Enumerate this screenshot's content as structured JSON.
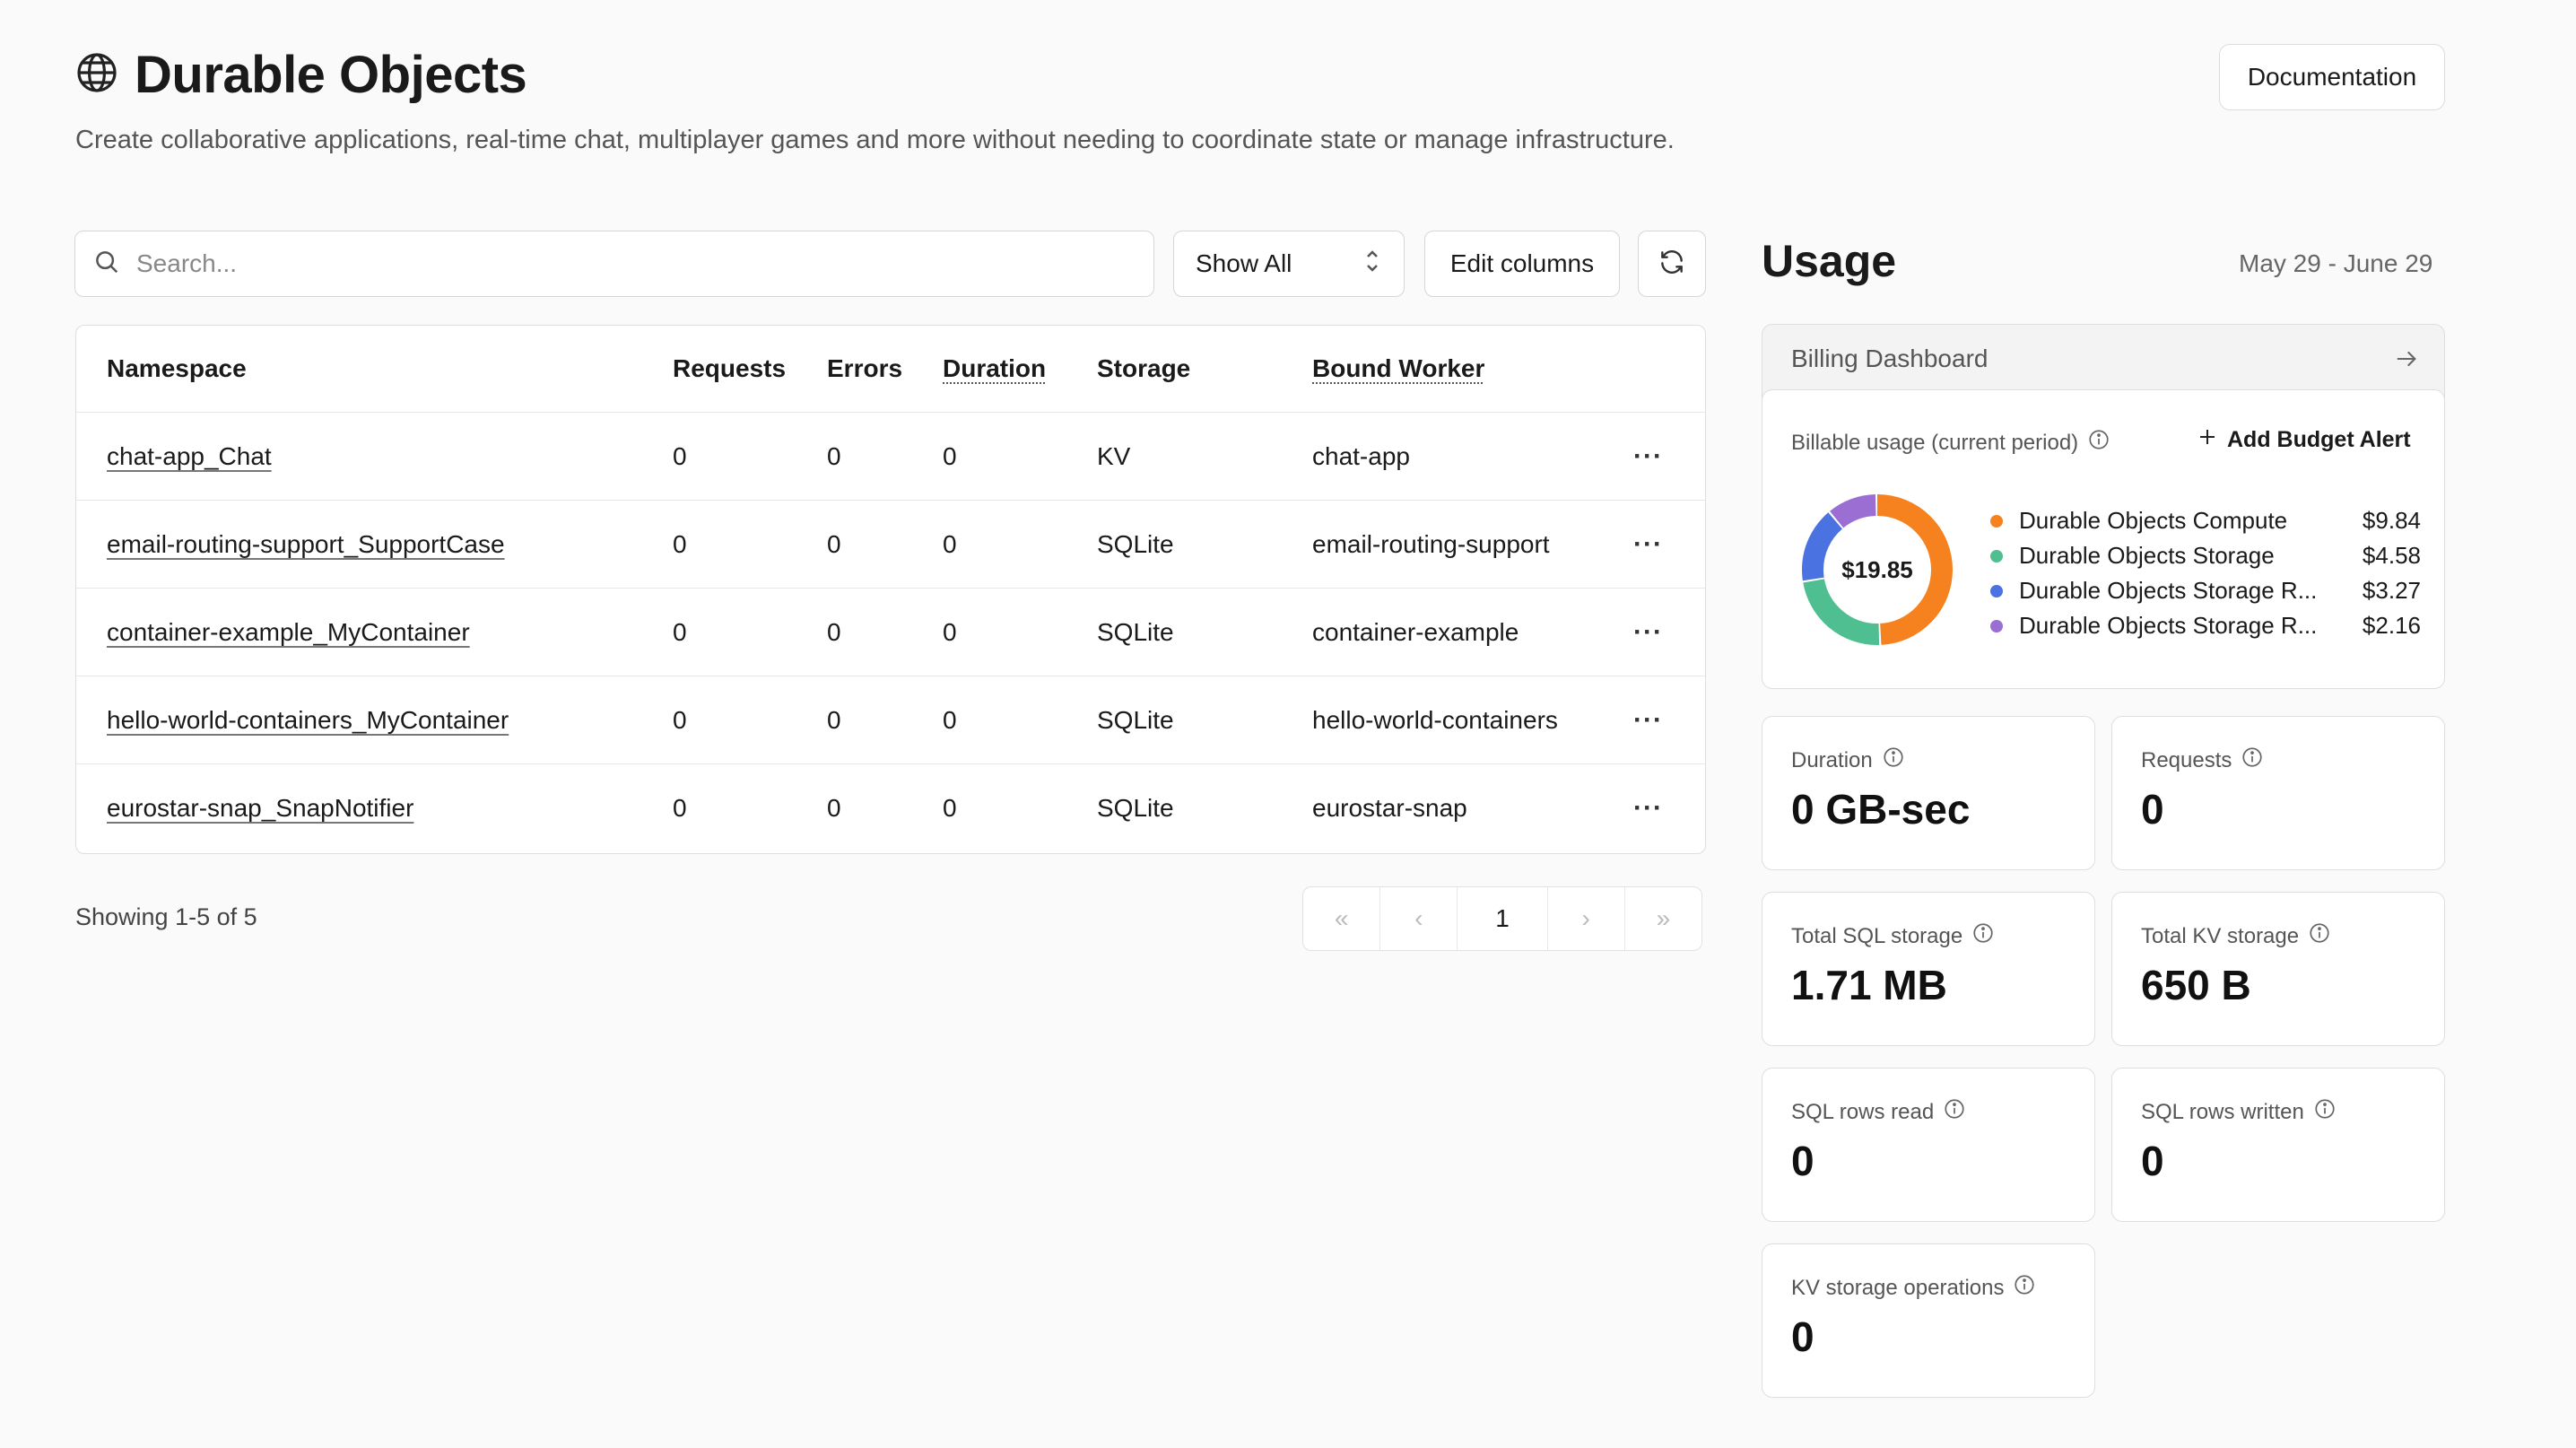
{
  "page": {
    "title": "Durable Objects",
    "subtitle": "Create collaborative applications, real-time chat, multiplayer games and more without needing to coordinate state or manage infrastructure.",
    "documentation_label": "Documentation",
    "icon": "globe-icon"
  },
  "toolbar": {
    "search_placeholder": "Search...",
    "filter_label": "Show All",
    "edit_columns_label": "Edit columns",
    "refresh_icon": "refresh-icon"
  },
  "table": {
    "columns": {
      "namespace": "Namespace",
      "requests": "Requests",
      "errors": "Errors",
      "duration": "Duration",
      "storage": "Storage",
      "bound_worker": "Bound Worker"
    },
    "rows": [
      {
        "namespace": "chat-app_Chat",
        "requests": "0",
        "errors": "0",
        "duration": "0",
        "storage": "KV",
        "bound_worker": "chat-app"
      },
      {
        "namespace": "email-routing-support_SupportCase",
        "requests": "0",
        "errors": "0",
        "duration": "0",
        "storage": "SQLite",
        "bound_worker": "email-routing-support"
      },
      {
        "namespace": "container-example_MyContainer",
        "requests": "0",
        "errors": "0",
        "duration": "0",
        "storage": "SQLite",
        "bound_worker": "container-example"
      },
      {
        "namespace": "hello-world-containers_MyContainer",
        "requests": "0",
        "errors": "0",
        "duration": "0",
        "storage": "SQLite",
        "bound_worker": "hello-world-containers"
      },
      {
        "namespace": "eurostar-snap_SnapNotifier",
        "requests": "0",
        "errors": "0",
        "duration": "0",
        "storage": "SQLite",
        "bound_worker": "eurostar-snap"
      }
    ],
    "showing_text": "Showing 1-5 of 5"
  },
  "pagination": {
    "current_page": "1",
    "first": "«",
    "prev": "‹",
    "next": "›",
    "last": "»"
  },
  "usage": {
    "title": "Usage",
    "date_range": "May 29 - June 29",
    "billing_dashboard_label": "Billing Dashboard",
    "billable_label": "Billable usage (current period)",
    "add_budget_alert_label": "Add Budget Alert",
    "total": "$19.85",
    "breakdown": [
      {
        "name": "Durable Objects Compute",
        "value": "$9.84",
        "amount": 9.84,
        "color": "#f6821f"
      },
      {
        "name": "Durable Objects Storage",
        "value": "$4.58",
        "amount": 4.58,
        "color": "#4fbf91"
      },
      {
        "name": "Durable Objects Storage R...",
        "value": "$3.27",
        "amount": 3.27,
        "color": "#4a72e0"
      },
      {
        "name": "Durable Objects Storage R...",
        "value": "$2.16",
        "amount": 2.16,
        "color": "#9b6ed4"
      }
    ],
    "metrics": {
      "duration": {
        "label": "Duration",
        "value": "0 GB-sec"
      },
      "requests": {
        "label": "Requests",
        "value": "0"
      },
      "sql_storage": {
        "label": "Total SQL storage",
        "value": "1.71 MB"
      },
      "kv_storage": {
        "label": "Total KV storage",
        "value": "650 B"
      },
      "sql_rows_read": {
        "label": "SQL rows read",
        "value": "0"
      },
      "sql_rows_written": {
        "label": "SQL rows written",
        "value": "0"
      },
      "kv_ops": {
        "label": "KV storage operations",
        "value": "0"
      }
    }
  }
}
